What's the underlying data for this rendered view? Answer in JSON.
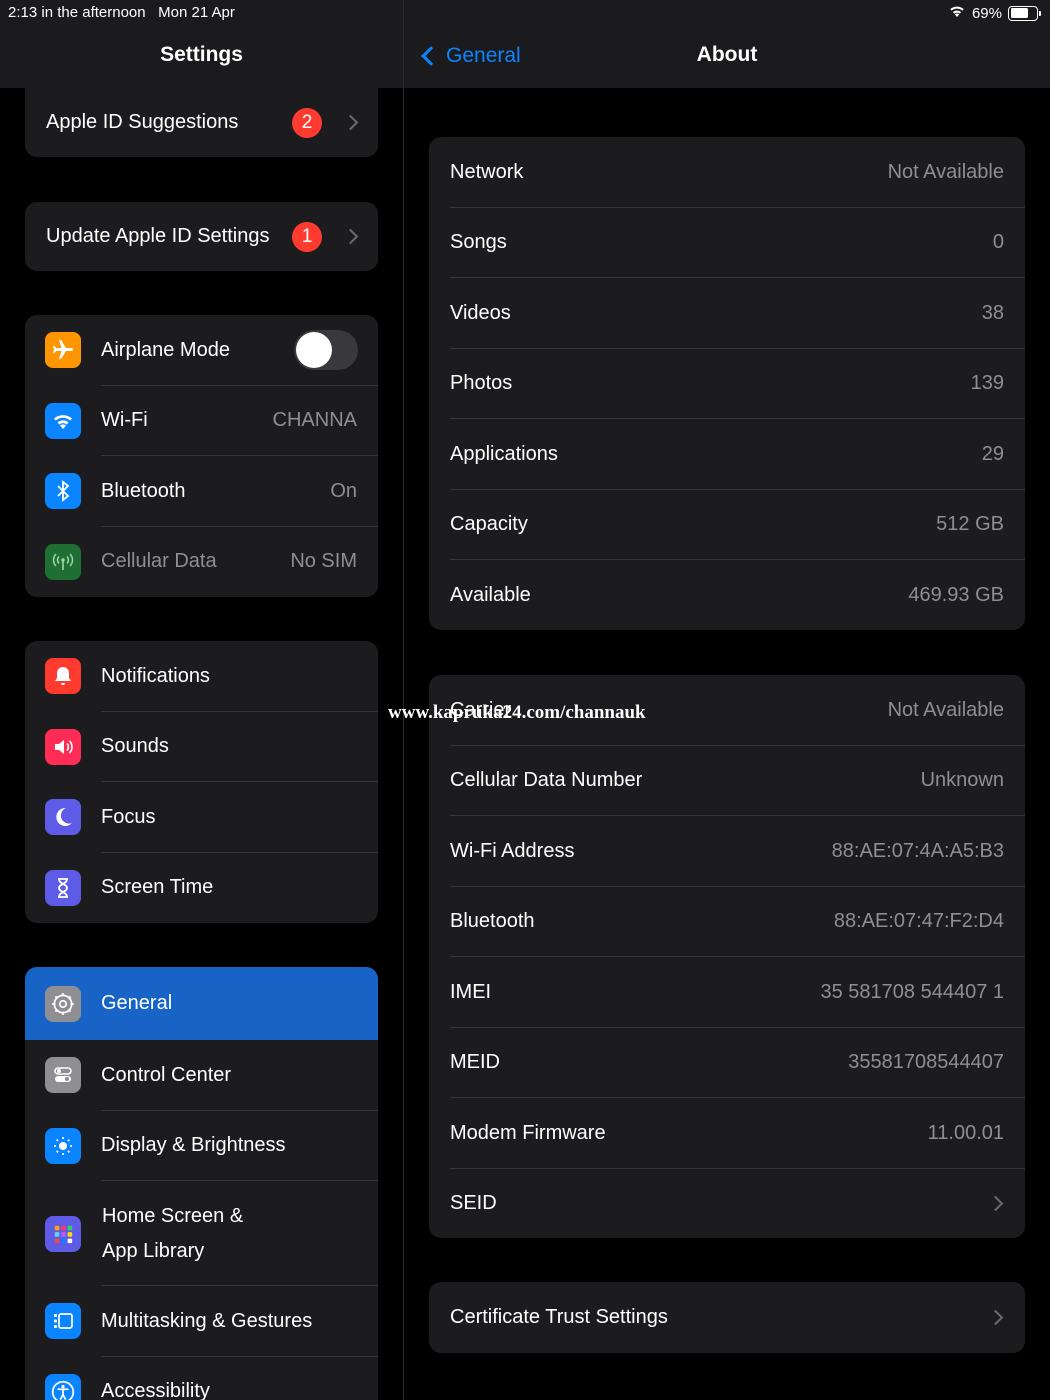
{
  "status": {
    "time": "2:13 in the afternoon",
    "date": "Mon 21 Apr",
    "battery": "69%",
    "battery_level": 0.69
  },
  "left": {
    "title": "Settings",
    "apple_id_suggestions": {
      "label": "Apple ID Suggestions",
      "badge": "2"
    },
    "update_apple_id": {
      "label": "Update Apple ID Settings",
      "badge": "1"
    },
    "connectivity": [
      {
        "label": "Airplane Mode",
        "icon": "airplane-icon",
        "color": "#ff9500",
        "toggle_on": false
      },
      {
        "label": "Wi-Fi",
        "value": "CHANNA",
        "icon": "wifi-icon",
        "color": "#0a84ff"
      },
      {
        "label": "Bluetooth",
        "value": "On",
        "icon": "bluetooth-icon",
        "color": "#0a84ff"
      },
      {
        "label": "Cellular Data",
        "value": "No SIM",
        "icon": "cellular-icon",
        "color": "#30d158"
      }
    ],
    "notifications": [
      {
        "label": "Notifications",
        "icon": "bell-icon",
        "color": "#ff3b30"
      },
      {
        "label": "Sounds",
        "icon": "speaker-icon",
        "color": "#ff2d55"
      },
      {
        "label": "Focus",
        "icon": "moon-icon",
        "color": "#5e5ce6"
      },
      {
        "label": "Screen Time",
        "icon": "hourglass-icon",
        "color": "#5e5ce6"
      }
    ],
    "general": [
      {
        "label": "General",
        "icon": "gear-icon",
        "color": "#8e8e93"
      },
      {
        "label": "Control Center",
        "icon": "switches-icon",
        "color": "#8e8e93"
      },
      {
        "label": "Display & Brightness",
        "icon": "sun-icon",
        "color": "#0a84ff"
      },
      {
        "label": "Home Screen &",
        "label2": "App Library",
        "icon": "grid-icon",
        "color": "#5e5ce6"
      },
      {
        "label": "Multitasking & Gestures",
        "icon": "multitask-icon",
        "color": "#0a84ff"
      },
      {
        "label": "Accessibility",
        "icon": "accessibility-icon",
        "color": "#0a84ff"
      }
    ]
  },
  "right": {
    "back_label": "General",
    "title": "About",
    "media": [
      {
        "label": "Network",
        "value": "Not Available"
      },
      {
        "label": "Songs",
        "value": "0"
      },
      {
        "label": "Videos",
        "value": "38"
      },
      {
        "label": "Photos",
        "value": "139"
      },
      {
        "label": "Applications",
        "value": "29"
      },
      {
        "label": "Capacity",
        "value": "512 GB"
      },
      {
        "label": "Available",
        "value": "469.93 GB"
      }
    ],
    "hardware": [
      {
        "label": "Carrier",
        "value": "Not Available"
      },
      {
        "label": "Cellular Data Number",
        "value": "Unknown"
      },
      {
        "label": "Wi-Fi Address",
        "value": "88:AE:07:4A:A5:B3"
      },
      {
        "label": "Bluetooth",
        "value": "88:AE:07:47:F2:D4"
      },
      {
        "label": "IMEI",
        "value": "35 581708 544407 1"
      },
      {
        "label": "MEID",
        "value": "35581708544407"
      },
      {
        "label": "Modem Firmware",
        "value": "11.00.01"
      },
      {
        "label": "SEID",
        "value": ""
      }
    ],
    "certificate": {
      "label": "Certificate Trust Settings"
    }
  },
  "watermark": "www.kapruka24.com/channauk"
}
